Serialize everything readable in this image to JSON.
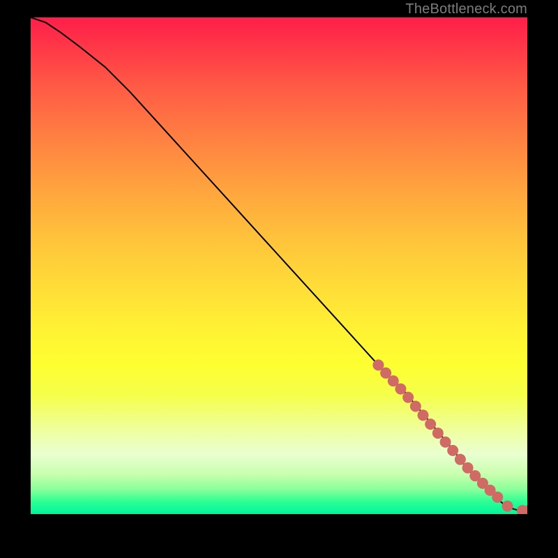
{
  "watermark": "TheBottleneck.com",
  "chart_data": {
    "type": "line",
    "title": "",
    "xlabel": "",
    "ylabel": "",
    "xlim": [
      0,
      100
    ],
    "ylim": [
      0,
      100
    ],
    "grid": false,
    "series": [
      {
        "name": "curve",
        "style": "line",
        "color": "#000000",
        "x": [
          0,
          3,
          6,
          10,
          15,
          20,
          30,
          40,
          50,
          60,
          70,
          75,
          80,
          85,
          88,
          90,
          92,
          94,
          95,
          96,
          97,
          98,
          99,
          100
        ],
        "values": [
          100,
          99,
          97,
          94,
          90,
          85,
          74,
          63,
          52,
          41,
          30,
          25,
          19,
          13,
          9,
          7,
          5,
          3,
          2.2,
          1.6,
          1.1,
          0.8,
          0.7,
          0.6
        ]
      },
      {
        "name": "markers",
        "style": "scatter",
        "color": "#cf6a64",
        "x": [
          70.0,
          71.5,
          73.0,
          74.5,
          76.0,
          77.5,
          79.0,
          80.5,
          82.0,
          83.5,
          85.0,
          86.5,
          88.0,
          89.5,
          91.0,
          92.5,
          94.0,
          96.0,
          99.0,
          100.0
        ],
        "values": [
          30.0,
          28.4,
          26.8,
          25.2,
          23.5,
          21.7,
          19.9,
          18.1,
          16.3,
          14.5,
          12.8,
          11.0,
          9.3,
          7.7,
          6.2,
          4.8,
          3.4,
          1.6,
          0.7,
          0.6
        ]
      }
    ]
  }
}
